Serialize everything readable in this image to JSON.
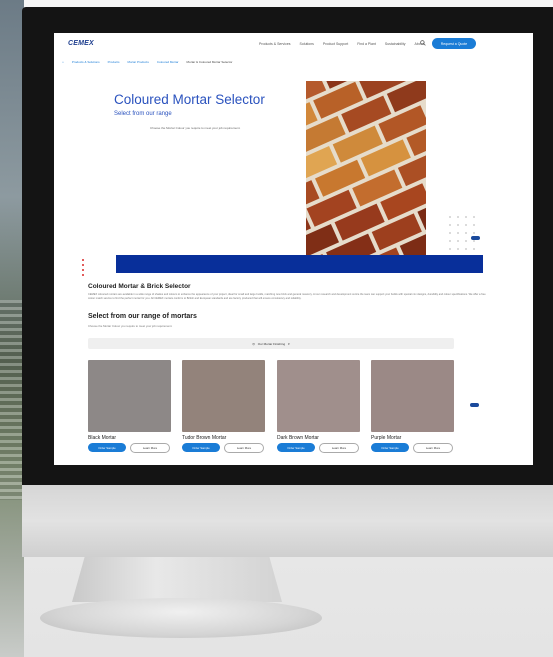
{
  "nav": {
    "logo": "CEMEX",
    "links": [
      "Products & Services",
      "Solutions",
      "Product Support",
      "Find a Plant",
      "Sustainability",
      "About"
    ],
    "search_icon": "search-icon",
    "cta": "Request a Quote"
  },
  "breadcrumb": [
    "Products & Solutions",
    "Products",
    "Mortar Products",
    "Coloured Mortar",
    "Mortar & Coloured Mortar Selector"
  ],
  "hero": {
    "title": "Coloured Mortar Selector",
    "subtitle": "Select from our range",
    "description": "Choose the Mortar Colour you require to meet your job requirement."
  },
  "section": {
    "title": "Coloured Mortar & Brick Selector",
    "paragraph": "CEMEX coloured mortars are available in a wide range of shades and colours to enhance the appearance of your project, ideal for small and large builds, matching new brick and general masonry. At our research and development centre the team can support your builds with special mix designs, durability and colour specifications. We offer a free colour match service to find the perfect mortar for you. All CEMEX mortars conform to British and European standards and are factory produced that will ensure consistency and reliability."
  },
  "range": {
    "title": "Select from our range of mortars",
    "description": "Choose the Mortar Colour you require to meet your job requirement.",
    "filter_label": "Our Mortar Finishing"
  },
  "cards": [
    {
      "label": "Black Mortar",
      "color": "#8d8887",
      "primary": "Order Sample",
      "secondary": "Learn More"
    },
    {
      "label": "Tudor Brown Mortar",
      "color": "#93837b",
      "primary": "Order Sample",
      "secondary": "Learn More"
    },
    {
      "label": "Dark Brown Mortar",
      "color": "#a08f8c",
      "primary": "Order Sample",
      "secondary": "Learn More"
    },
    {
      "label": "Purple Mortar",
      "color": "#9b8986",
      "primary": "Order Sample",
      "secondary": "Learn More"
    }
  ],
  "colors": {
    "brand_blue": "#1a7cd6",
    "title_blue": "#2a52be",
    "band_navy": "#082f9a"
  }
}
